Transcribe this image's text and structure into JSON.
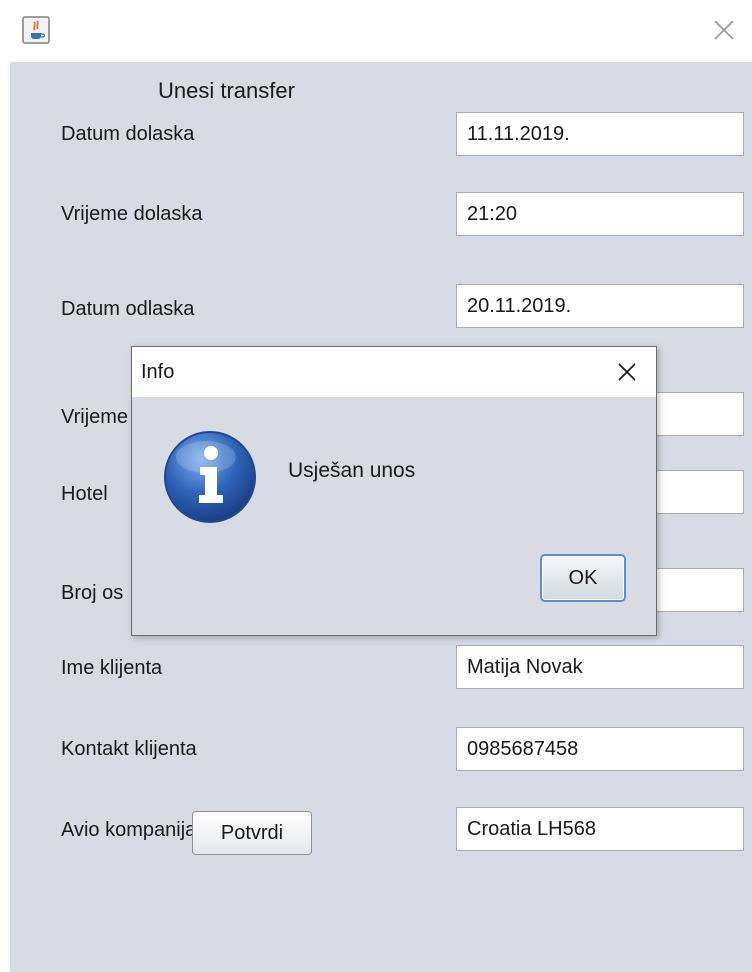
{
  "window": {
    "app_icon": "java-cup-icon",
    "close_icon": "close-icon"
  },
  "form": {
    "heading": "Unesi transfer",
    "rows": [
      {
        "label": "Datum dolaska",
        "value": "11.11.2019."
      },
      {
        "label": "Vrijeme dolaska",
        "value": "21:20"
      },
      {
        "label": "Datum odlaska",
        "value": "20.11.2019."
      },
      {
        "label": "Vrijeme",
        "value": ""
      },
      {
        "label": "Hotel",
        "value": ""
      },
      {
        "label": "Broj os",
        "value": ""
      },
      {
        "label": "Ime klijenta",
        "value": "Matija Novak"
      },
      {
        "label": "Kontakt klijenta",
        "value": "0985687458"
      },
      {
        "label": "Avio kompanija/ broj leta",
        "value": "Croatia LH568"
      }
    ],
    "confirm_label": "Potvrdi"
  },
  "dialog": {
    "title": "Info",
    "message": "Usješan unos",
    "ok_label": "OK",
    "icon": "info-icon"
  },
  "colors": {
    "window_bg": "#d8dbe3",
    "info_icon_blue": "#2f64b8",
    "ok_border": "#5a8fc7"
  }
}
